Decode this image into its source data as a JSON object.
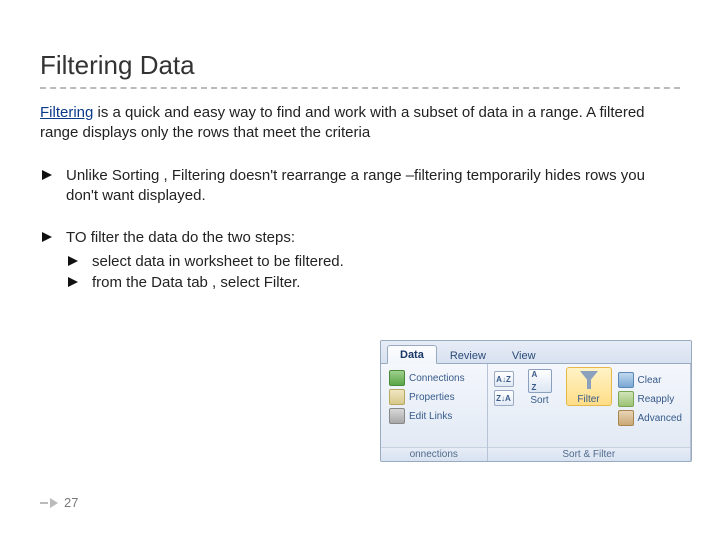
{
  "title": "Filtering Data",
  "intro": {
    "keyword": "Filtering",
    "rest": " is a quick and easy way to find and work with a subset of data in a range. A filtered range displays only the rows that meet the criteria"
  },
  "bullets": [
    "Unlike Sorting , Filtering doesn't rearrange a range –filtering temporarily hides rows you don't want displayed."
  ],
  "bullet2": {
    "lead": "TO filter the data do the two steps:",
    "subs": [
      "select data in worksheet to be filtered.",
      "from the Data tab , select Filter."
    ]
  },
  "ribbon": {
    "tabs": [
      "Data",
      "Review",
      "View"
    ],
    "active_tab_index": 0,
    "group_connections": {
      "label": "onnections",
      "items": [
        "Connections",
        "Properties",
        "Edit Links"
      ]
    },
    "group_sortfilter": {
      "label": "Sort & Filter",
      "az": "A↓Z",
      "za": "Z↓A",
      "sort": "Sort",
      "filter": "Filter",
      "clear": "Clear",
      "reapply": "Reapply",
      "advanced": "Advanced"
    }
  },
  "page_number": "27"
}
